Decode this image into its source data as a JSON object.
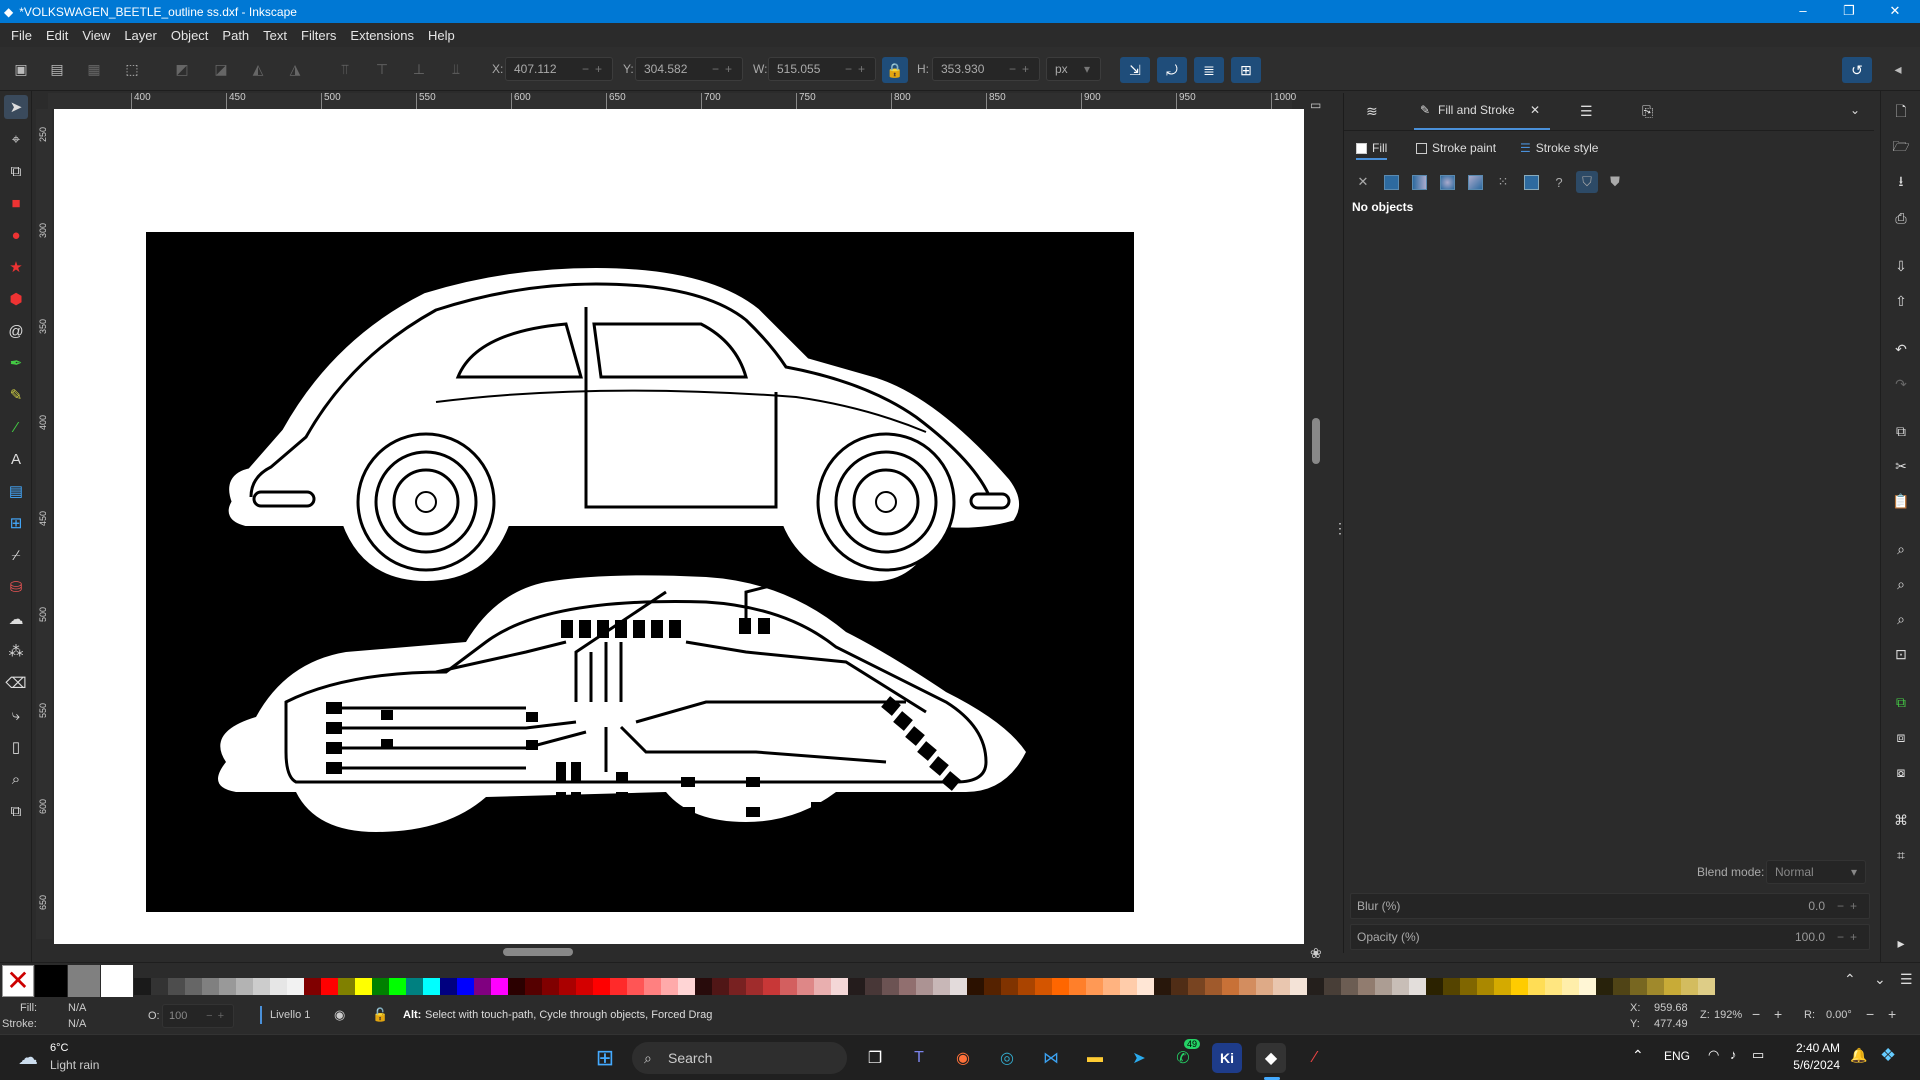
{
  "window": {
    "title": "*VOLKSWAGEN_BEETLE_outline ss.dxf - Inkscape",
    "minimize": "–",
    "maximize": "❐",
    "close": "✕"
  },
  "menu": [
    "File",
    "Edit",
    "View",
    "Layer",
    "Object",
    "Path",
    "Text",
    "Filters",
    "Extensions",
    "Help"
  ],
  "toolbar": {
    "x_label": "X:",
    "x": "407.112",
    "y_label": "Y:",
    "y": "304.582",
    "w_label": "W:",
    "w": "515.055",
    "h_label": "H:",
    "h": "353.930",
    "unit": "px"
  },
  "ruler": {
    "h_ticks": [
      "400",
      "450",
      "500",
      "550",
      "600",
      "650",
      "700",
      "750",
      "800",
      "850",
      "900",
      "950",
      "1000"
    ],
    "v_ticks": [
      "250",
      "300",
      "350",
      "400",
      "450",
      "500",
      "550",
      "600",
      "650"
    ]
  },
  "panel": {
    "tab_active": "Fill and Stroke",
    "subtabs": [
      "Fill",
      "Stroke paint",
      "Stroke style"
    ],
    "status": "No objects",
    "blend_label": "Blend mode:",
    "blend_value": "Normal",
    "blur_label": "Blur (%)",
    "blur_value": "0.0",
    "opacity_label": "Opacity (%)",
    "opacity_value": "100.0"
  },
  "status": {
    "fill_label": "Fill:",
    "fill_value": "N/A",
    "stroke_label": "Stroke:",
    "stroke_value": "N/A",
    "o_label": "O:",
    "o_value": "100",
    "layer": "Livello 1",
    "hint_bold": "Alt:",
    "hint": "Select with touch-path, Cycle through objects, Forced Drag",
    "x_label": "X:",
    "x": "959.68",
    "y_label": "Y:",
    "y": "477.49",
    "zoom_label": "Z:",
    "zoom": "192%",
    "rot_label": "R:",
    "rot": "0.00°"
  },
  "taskbar": {
    "weather_temp": "6°C",
    "weather_text": "Light rain",
    "search": "Search",
    "lang": "ENG",
    "time": "2:40 AM",
    "date": "5/6/2024",
    "whatsapp_badge": "49"
  },
  "palette_colors": [
    "#1a1a1a",
    "#333",
    "#4d4d4d",
    "#666",
    "#808080",
    "#999",
    "#b3b3b3",
    "#ccc",
    "#e6e6e6",
    "#f2f2f2",
    "#800000",
    "#ff0000",
    "#808000",
    "#ffff00",
    "#008000",
    "#00ff00",
    "#008080",
    "#00ffff",
    "#000080",
    "#0000ff",
    "#800080",
    "#ff00ff",
    "#2b0000",
    "#550000",
    "#800000",
    "#aa0000",
    "#d40000",
    "#ff0000",
    "#ff2a2a",
    "#ff5555",
    "#ff8080",
    "#ffaaaa",
    "#ffd5d5",
    "#280b0b",
    "#501616",
    "#782121",
    "#a02c2c",
    "#c83737",
    "#d35f5f",
    "#de8787",
    "#e9afaf",
    "#f4d7d7",
    "#241c1c",
    "#483737",
    "#6c5353",
    "#916f6f",
    "#ac9393",
    "#c8b7b7",
    "#e3dbdb",
    "#2b1100",
    "#552200",
    "#803300",
    "#aa4400",
    "#d45500",
    "#ff6600",
    "#ff7f2a",
    "#ff9955",
    "#ffb380",
    "#ffccaa",
    "#ffe6d5",
    "#28170b",
    "#502d16",
    "#784421",
    "#a05a2c",
    "#c87137",
    "#d38d5f",
    "#deaa87",
    "#e9c6af",
    "#f4e3d7",
    "#241f1c",
    "#483e37",
    "#6c5d53",
    "#917c6f",
    "#ac9d93",
    "#c8beb7",
    "#e3dedb",
    "#2b2200",
    "#554400",
    "#806600",
    "#aa8800",
    "#d4aa00",
    "#ffcc00",
    "#ffdd55",
    "#ffe680",
    "#ffeeaa",
    "#fff6d5",
    "#28220b",
    "#504416",
    "#786721",
    "#a0892c",
    "#c8ab37",
    "#d3bc5f",
    "#decd87"
  ]
}
